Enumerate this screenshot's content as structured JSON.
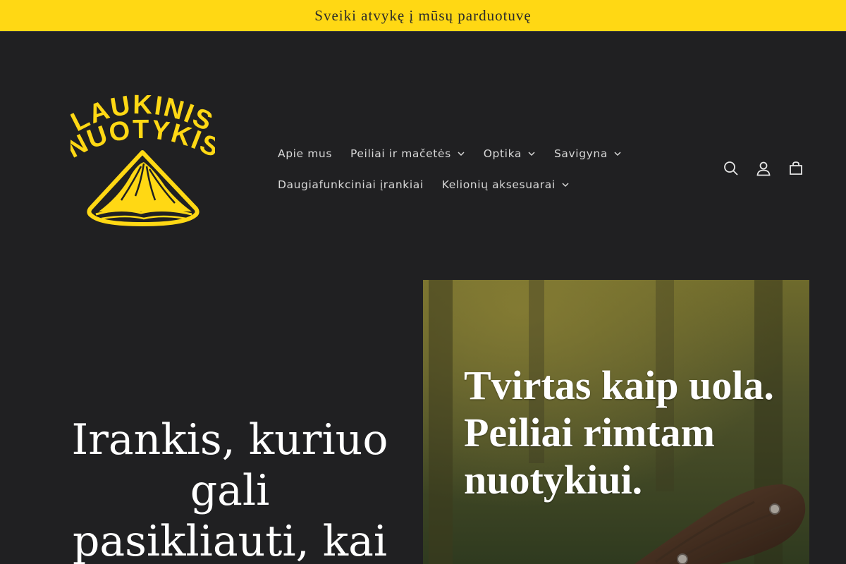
{
  "announcement": {
    "text": "Sveiki atvykę į mūsų parduotuvę"
  },
  "brand": {
    "line1": "LAUKINIS",
    "line2": "NUOTYKIS",
    "color": "#ffd814"
  },
  "nav": {
    "row1": [
      {
        "label": "Apie mus",
        "has_dropdown": false
      },
      {
        "label": "Peiliai ir mačetės",
        "has_dropdown": true
      },
      {
        "label": "Optika",
        "has_dropdown": true
      },
      {
        "label": "Savigyna",
        "has_dropdown": true
      }
    ],
    "row2": [
      {
        "label": "Daugiafunkciniai įrankiai",
        "has_dropdown": false
      },
      {
        "label": "Kelionių aksesuarai",
        "has_dropdown": true
      }
    ]
  },
  "header_icons": [
    "search-icon",
    "account-icon",
    "cart-icon"
  ],
  "hero": {
    "heading": "Irankis, kuriuo gali pasikliauti, kai",
    "image_caption": {
      "line1": "Tvirtas kaip uola.",
      "line2": "Peiliai rimtam",
      "line3": "nuotykiui."
    }
  },
  "colors": {
    "background": "#202022",
    "accent": "#ffd814",
    "text": "#ffffff"
  }
}
